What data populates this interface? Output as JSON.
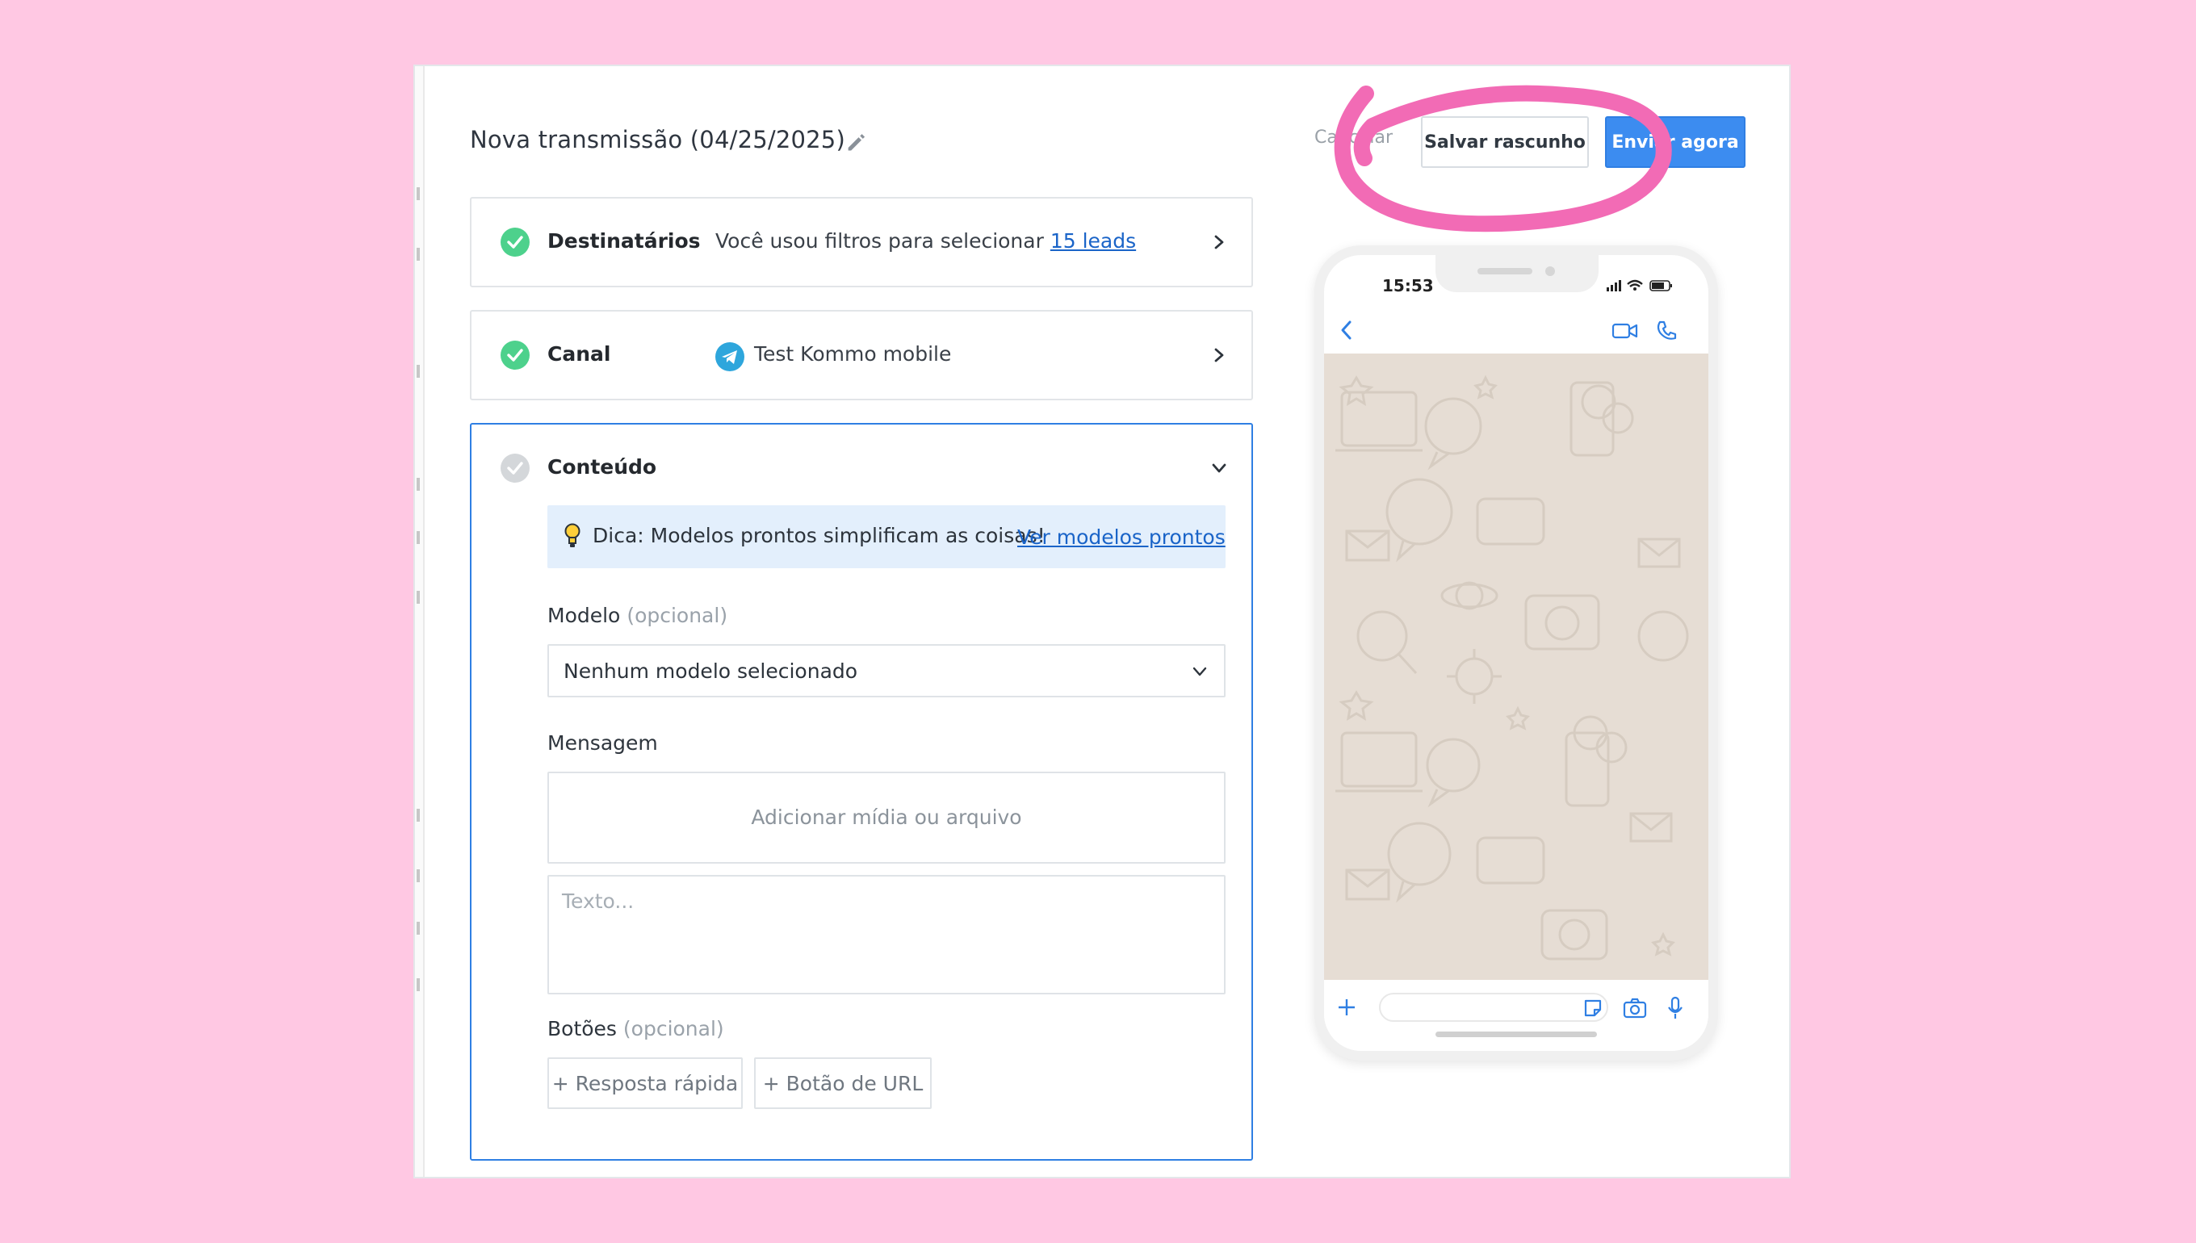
{
  "app": {
    "title": "Nova transmissão (04/25/2025)",
    "header_buttons": {
      "cancel": "Cancelar",
      "save_draft": "Salvar rascunho",
      "send_now": "Enviar agora"
    }
  },
  "steps": {
    "recipients": {
      "label": "Destinatários",
      "description": "Você usou filtros para selecionar ",
      "link": "15 leads"
    },
    "canal": {
      "label": "Canal",
      "channel_name": "Test Kommo mobile"
    },
    "content": {
      "label": "Conteúdo",
      "tip_text": "Dica: Modelos prontos simplificam as coisas!",
      "tip_link": "Ver modelos prontos",
      "model_label": "Modelo",
      "model_optional": "(opcional)",
      "model_value": "Nenhum modelo selecionado",
      "message_label": "Mensagem",
      "media_placeholder": "Adicionar mídia ou arquivo",
      "text_placeholder": "Texto...",
      "buttons_label": "Botões",
      "buttons_optional": "(opcional)",
      "quick_reply": "+ Resposta rápida",
      "url_button": "+ Botão de URL"
    }
  },
  "phone_preview": {
    "time": "15:53"
  },
  "colors": {
    "page_background": "#ffc8e3",
    "accent_blue": "#3c8cf0",
    "success_green": "#4dd18c",
    "annotation_pink": "#f26bb5",
    "chat_wallpaper": "#e6ddd4"
  },
  "icons": [
    "pencil-icon",
    "check-icon",
    "chevron-right-icon",
    "chevron-down-icon",
    "telegram-icon",
    "lightbulb-icon",
    "back-arrow-icon",
    "video-call-icon",
    "phone-call-icon",
    "plus-icon",
    "sticker-icon",
    "camera-icon",
    "microphone-icon"
  ]
}
